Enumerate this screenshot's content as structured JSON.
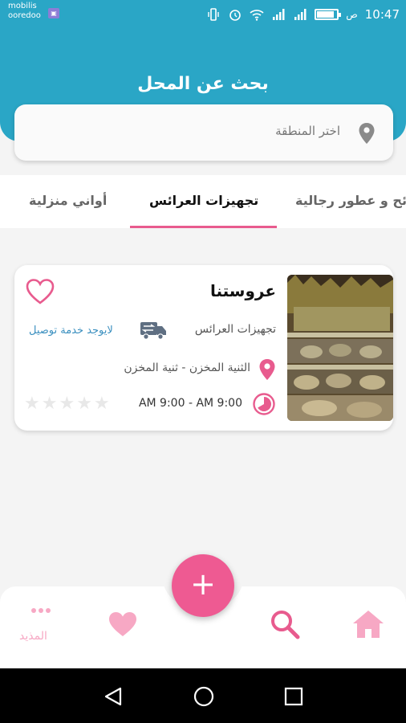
{
  "status_bar": {
    "carrier_line1": "mobilis",
    "carrier_line2": "ooredoo",
    "time": "10:47",
    "time_suffix": "ص"
  },
  "header": {
    "title": "بحث عن المحل",
    "region_placeholder": "اختر المنطقة"
  },
  "tabs": [
    {
      "label": "أواني منزلية"
    },
    {
      "label": "تجهيزات العرائس",
      "active": true
    },
    {
      "label": "ائح و عطور رجالية"
    }
  ],
  "card": {
    "shop_name": "عروستنا",
    "category": "تجهيزات العرائس",
    "delivery": "لايوجد خدمة توصيل",
    "address": "الثنية المخزن -  ثنية المخزن",
    "hours": "AM 9:00   -   AM 9:00",
    "rating": 0,
    "rating_max": 5
  },
  "bottom_nav": {
    "more_label": "المذيد",
    "fab_label": "+"
  },
  "colors": {
    "primary": "#2aa6c6",
    "accent": "#ee5a92"
  }
}
